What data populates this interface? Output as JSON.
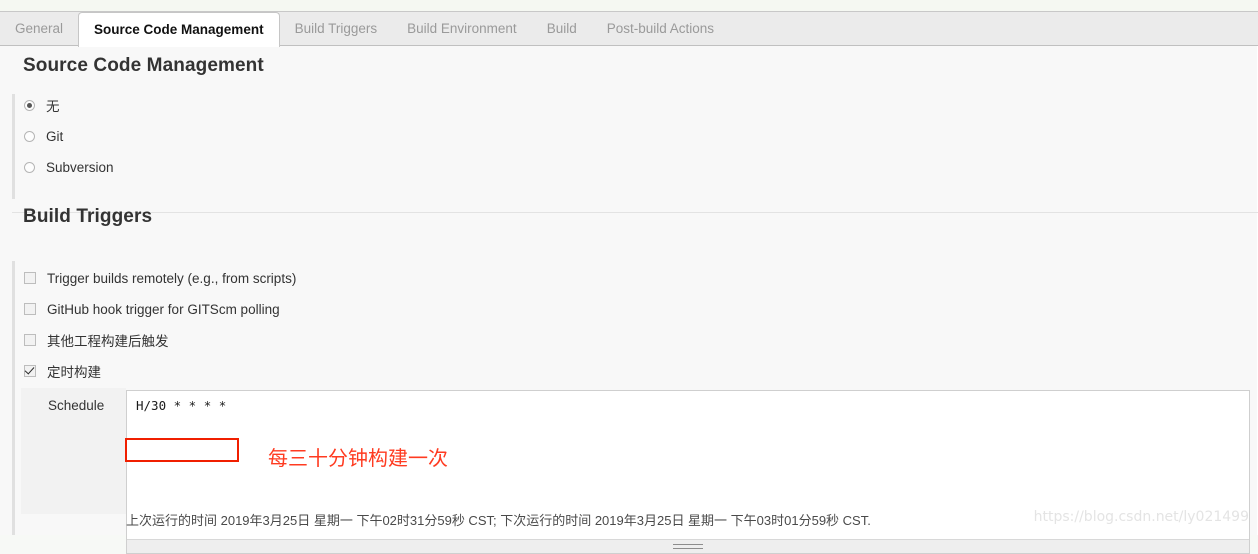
{
  "tabs": [
    {
      "label": "General",
      "active": false
    },
    {
      "label": "Source Code Management",
      "active": true
    },
    {
      "label": "Build Triggers",
      "active": false
    },
    {
      "label": "Build Environment",
      "active": false
    },
    {
      "label": "Build",
      "active": false
    },
    {
      "label": "Post-build Actions",
      "active": false
    }
  ],
  "scm": {
    "title": "Source Code Management",
    "options": [
      {
        "label": "无",
        "checked": true
      },
      {
        "label": "Git",
        "checked": false
      },
      {
        "label": "Subversion",
        "checked": false
      }
    ]
  },
  "build_triggers": {
    "title": "Build Triggers",
    "options": [
      {
        "label": "Trigger builds remotely (e.g., from scripts)",
        "checked": false
      },
      {
        "label": "GitHub hook trigger for GITScm polling",
        "checked": false
      },
      {
        "label": "其他工程构建后触发",
        "checked": false
      },
      {
        "label": "定时构建",
        "checked": true
      }
    ],
    "schedule": {
      "label": "Schedule",
      "value": "H/30 * * * *",
      "status": "上次运行的时间 2019年3月25日 星期一 下午02时31分59秒 CST; 下次运行的时间 2019年3月25日 星期一 下午03时01分59秒 CST."
    }
  },
  "annotation": {
    "note": "每三十分钟构建一次",
    "color": "#ff3b21"
  },
  "watermark": {
    "text": "https://blog.csdn.net/ly021499"
  }
}
